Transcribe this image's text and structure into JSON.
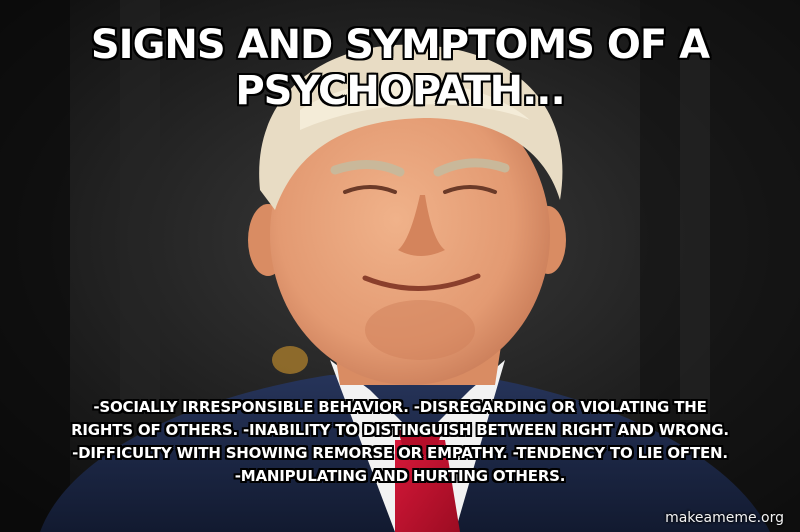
{
  "meme": {
    "top_text": "SIGNS AND SYMPTOMS OF A PSYCHOPATH...",
    "bottom_text": "-SOCIALLY IRRESPONSIBLE BEHAVIOR. -DISREGARDING OR VIOLATING THE RIGHTS OF OTHERS. -INABILITY TO DISTINGUISH BETWEEN RIGHT AND WRONG. -DIFFICULTY WITH SHOWING REMORSE OR EMPATHY. -TENDENCY TO LIE OFTEN. -MANIPULATING AND HURTING OTHERS.",
    "watermark": "makeameme.org"
  },
  "colors": {
    "text": "#ffffff",
    "outline": "#000000",
    "background": "#141414",
    "skin": "#e9a079",
    "hair": "#e8dcc4",
    "suit": "#1e2a4a",
    "shirt": "#f2f2f2",
    "tie": "#c8102e"
  }
}
